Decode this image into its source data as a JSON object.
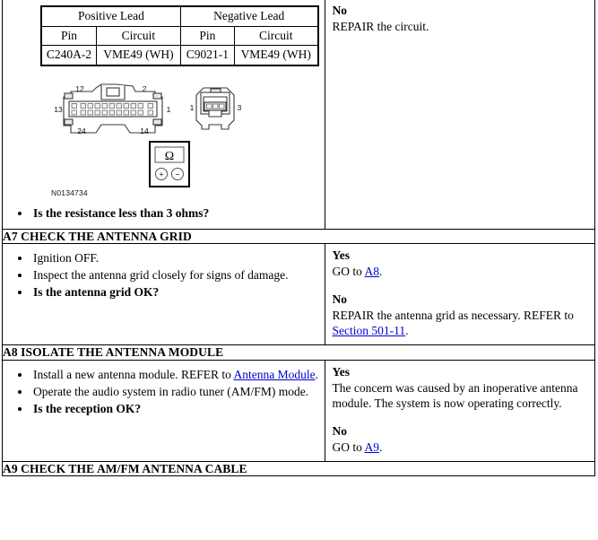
{
  "pin_table": {
    "lead_headers": [
      "Positive Lead",
      "Negative Lead"
    ],
    "sub_headers": [
      "Pin",
      "Circuit",
      "Pin",
      "Circuit"
    ],
    "row": [
      "C240A-2",
      "VME49 (WH)",
      "C9021-1",
      "VME49 (WH)"
    ]
  },
  "figure": {
    "id_label": "N0134734",
    "large_connector": {
      "pin_labels": [
        "12",
        "13",
        "24",
        "2",
        "1",
        "14"
      ]
    },
    "small_connector": {
      "pin_labels": [
        "1",
        "3"
      ]
    },
    "meter": {
      "symbol": "Ω",
      "positive_terminal": "+",
      "negative_terminal": "−"
    }
  },
  "rows": {
    "resistance_question": {
      "question": "Is the resistance less than 3 ohms?",
      "result_no_label": "No",
      "result_no_text": "REPAIR the circuit."
    },
    "a7": {
      "header": "A7 CHECK THE ANTENNA GRID",
      "steps": [
        "Ignition OFF.",
        "Inspect the antenna grid closely for signs of damage.",
        "Is the antenna grid OK?"
      ],
      "yes_label": "Yes",
      "yes_text_pre": "GO to ",
      "yes_link": "A8",
      "yes_text_post": ".",
      "no_label": "No",
      "no_text_pre": "REPAIR the antenna grid as necessary. REFER to ",
      "no_link": "Section 501-11",
      "no_text_post": "."
    },
    "a8": {
      "header": "A8 ISOLATE THE ANTENNA MODULE",
      "step1_pre": "Install a new antenna module. REFER to ",
      "step1_link": "Antenna Module",
      "step1_post": ".",
      "step2": "Operate the audio system in radio tuner (AM/FM) mode.",
      "step3": "Is the reception OK?",
      "yes_label": "Yes",
      "yes_text": "The concern was caused by an inoperative antenna module. The system is now operating correctly.",
      "no_label": "No",
      "no_text_pre": "GO to ",
      "no_link": "A9",
      "no_text_post": "."
    },
    "a9": {
      "header": "A9 CHECK THE AM/FM ANTENNA CABLE"
    }
  },
  "colors": {
    "link": "#0000cc",
    "border": "#000000",
    "text": "#000000"
  }
}
